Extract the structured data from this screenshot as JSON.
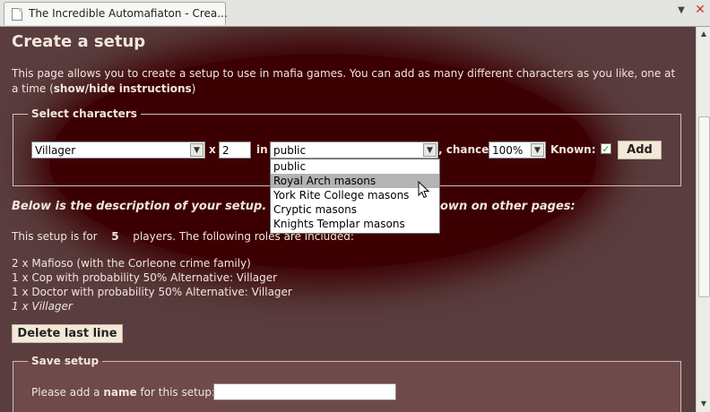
{
  "browser": {
    "tab_title": "The Incredible Automafiaton - Crea...",
    "tab_list_icon": "chevron-down-icon",
    "close_icon": "close-icon"
  },
  "page": {
    "title": "Create a setup",
    "intro_text": "This page allows you to create a setup to use in mafia games. You can add as many different characters as you like, one at a time (",
    "intro_link": "show/hide instructions",
    "intro_close": ")"
  },
  "select_characters": {
    "legend": "Select characters",
    "character_value": "Villager",
    "times_label": "x",
    "count_value": "2",
    "in_label": "in",
    "group_value": "public",
    "chance_label": ", chance",
    "chance_value": "100%",
    "known_label": "Known:",
    "known_checked": true,
    "add_label": "Add",
    "group_options": [
      "public",
      "Royal Arch masons",
      "York Rite College masons",
      "Cryptic masons",
      "Knights Templar masons"
    ],
    "highlighted_option": "Royal Arch masons"
  },
  "description": {
    "heading_left": "Below is the description of your setup. Ite",
    "heading_right": "own on other pages:",
    "players_prefix": "This setup is for",
    "players_count": "5",
    "players_suffix": "players. The following roles are included:",
    "roles": [
      "2 x Mafioso (with the Corleone crime family)",
      "1 x Cop with probability 50% Alternative: Villager",
      "1 x Doctor with probability 50% Alternative: Villager"
    ],
    "last_role": "1 x Villager",
    "delete_label": "Delete last line"
  },
  "save_setup": {
    "legend": "Save setup",
    "name_prefix": "Please add a ",
    "name_bold": "name",
    "name_suffix": " for this setup:",
    "name_value": ""
  },
  "colors": {
    "page_bg": "#5a3d3e",
    "spotlight": "#3c0003",
    "text": "#f1e6dc"
  }
}
